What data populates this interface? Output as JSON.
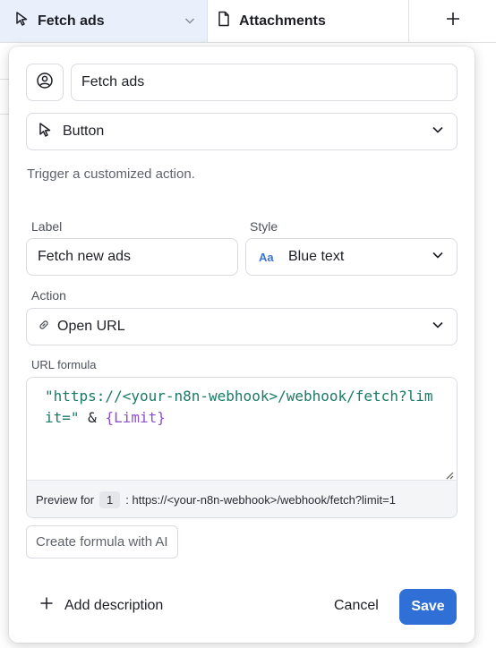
{
  "columns": {
    "fetch_ads": "Fetch ads",
    "attachments": "Attachments",
    "add_icon": "plus-icon"
  },
  "field": {
    "icon": "user-circle-icon",
    "name": "Fetch ads",
    "type": "Button",
    "description": "Trigger a customized action."
  },
  "button": {
    "label_heading": "Label",
    "label_value": "Fetch new ads",
    "style_heading": "Style",
    "style_icon": "Aa",
    "style_value": "Blue text",
    "action_heading": "Action",
    "action_value": "Open URL"
  },
  "formula": {
    "heading": "URL formula",
    "code_string": "\"https://<your-n8n-webhook>/webhook/fetch?limit=\"",
    "code_operator": " & ",
    "code_field": "{Limit}",
    "preview_prefix": "Preview for",
    "preview_row": "1",
    "preview_value": ": https://<your-n8n-webhook>/webhook/fetch?limit=1",
    "ai_button": "Create formula with AI"
  },
  "footer": {
    "add_description": "Add description",
    "cancel": "Cancel",
    "save": "Save"
  },
  "colors": {
    "accent": "#2f6fd6",
    "header_selected": "#e9f0fb",
    "formula_string": "#1a7a68",
    "formula_field": "#8e4fd1"
  }
}
